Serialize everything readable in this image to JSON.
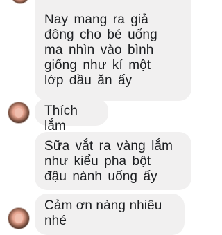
{
  "messages": [
    {
      "text": "Nay mang ra giả\nđông cho bé uống\nma nhìn vào bình\ngiống như kí một\nlớp dầu ăn ấy",
      "has_avatar": true,
      "avatar_partial": true
    },
    {
      "text": "Thích lắm",
      "has_avatar": true
    },
    {
      "text": "Sữa vắt ra vàng lắm\nnhư kiểu pha bột\nđậu nành uống ấy",
      "has_avatar": false
    },
    {
      "text": "Cảm ơn nàng nhiêu\nnhé",
      "has_avatar": true
    }
  ],
  "colors": {
    "bubble_background": "#f1f0f0",
    "text": "#1c1e21",
    "page_background": "#ffffff"
  }
}
